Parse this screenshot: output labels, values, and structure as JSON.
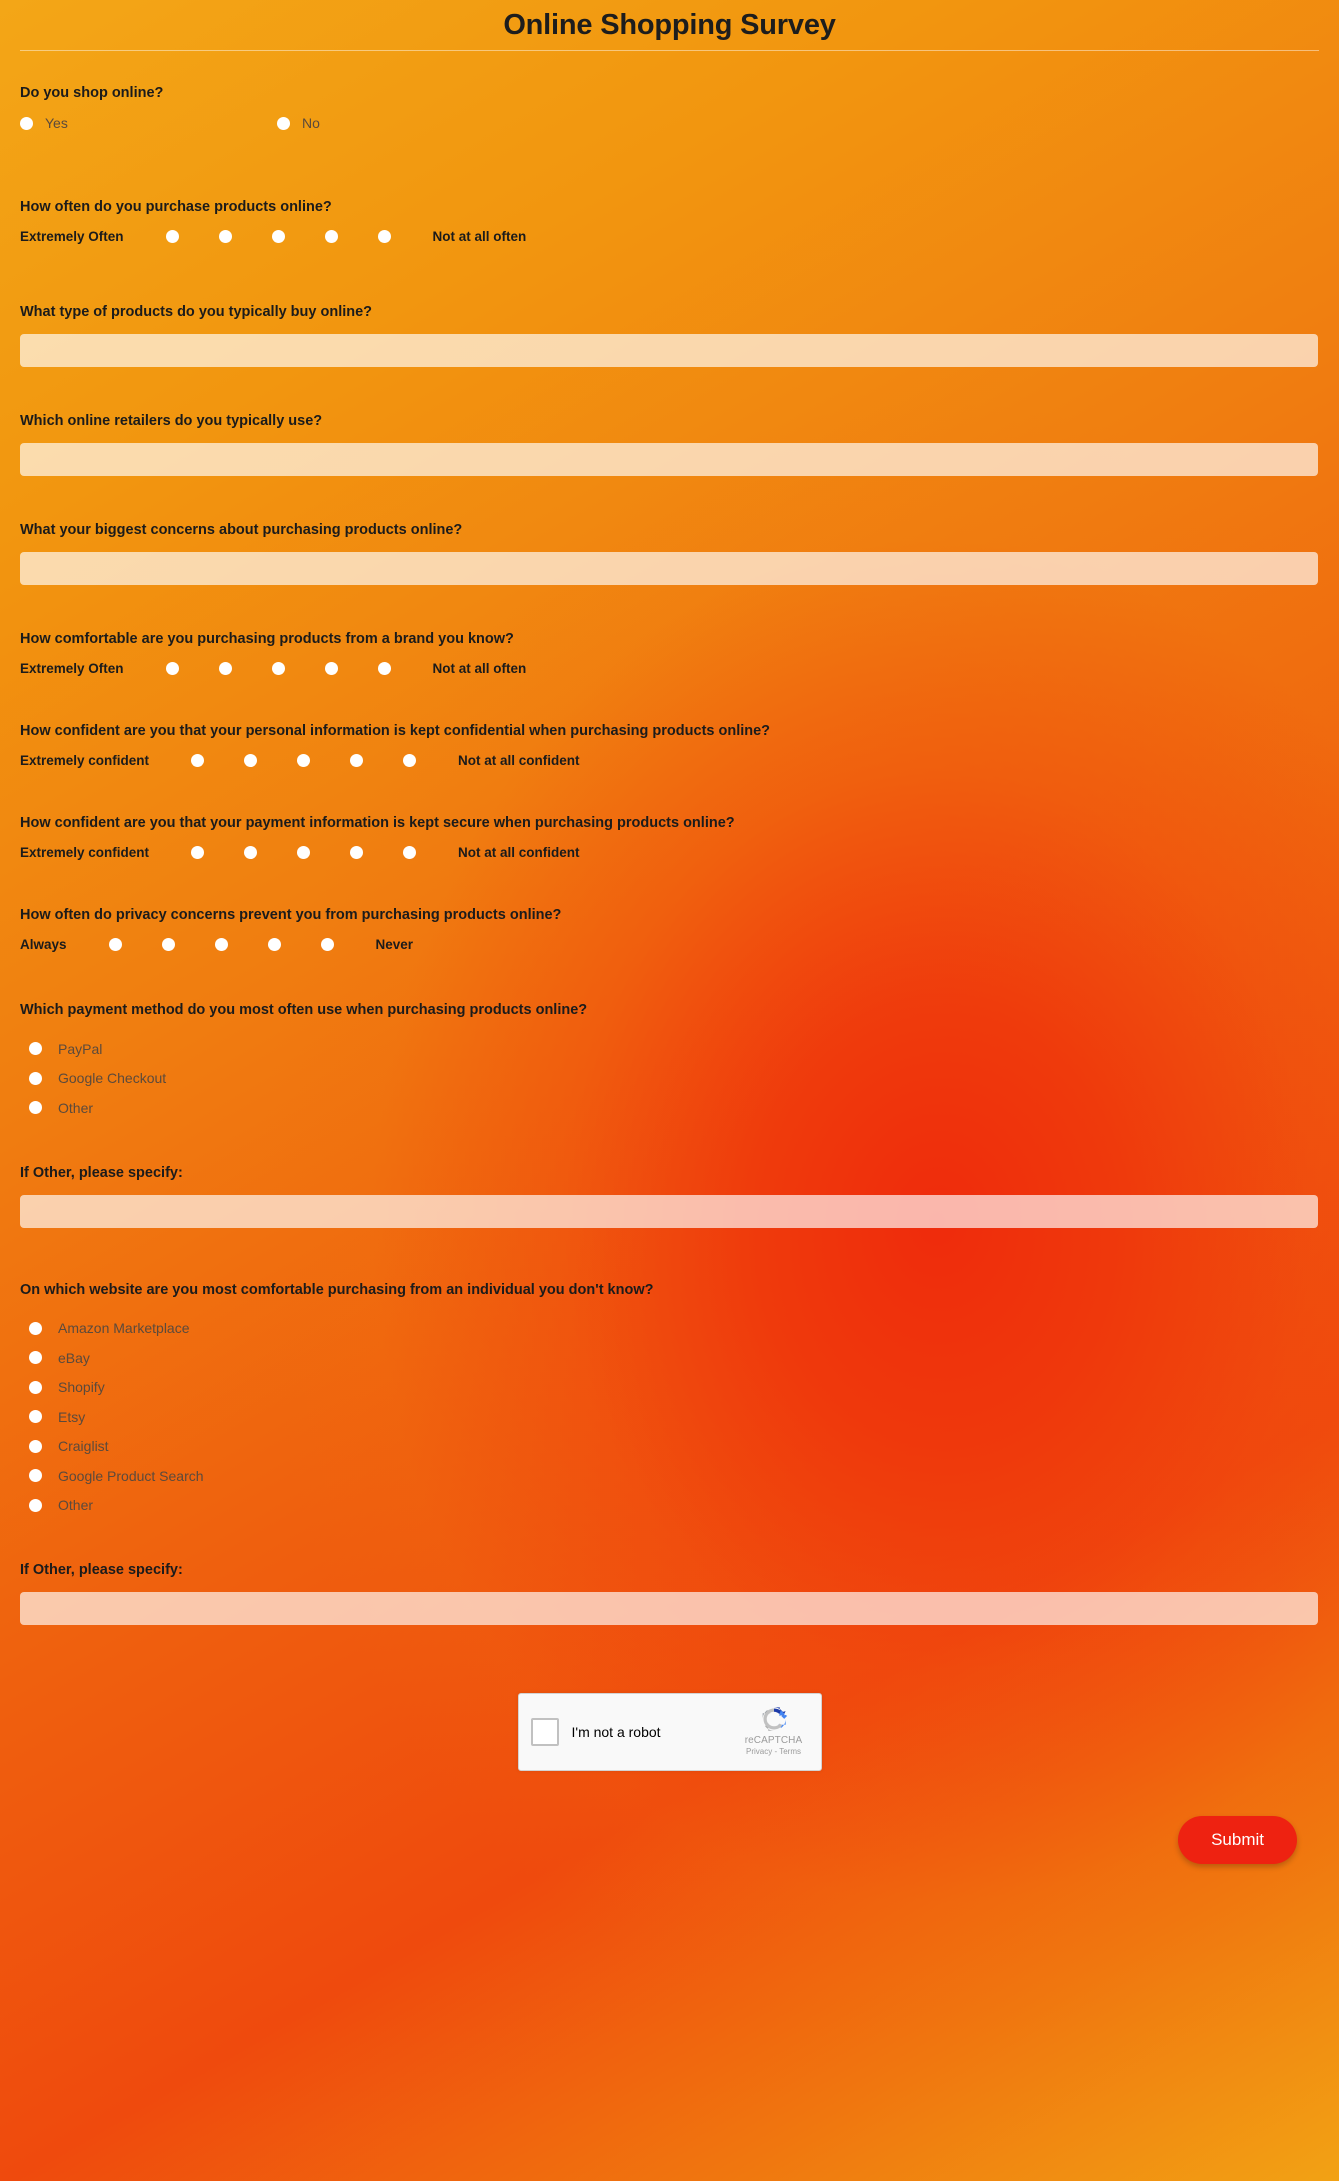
{
  "header": {
    "title": "Online Shopping Survey"
  },
  "questions": {
    "shop_online": {
      "label": "Do you shop online?",
      "options": [
        "Yes",
        "No"
      ]
    },
    "purchase_frequency": {
      "label": "How often do you purchase products online?",
      "left_anchor": "Extremely Often",
      "right_anchor": "Not at all often",
      "points": 5
    },
    "product_types": {
      "label": "What type of products do you typically buy online?",
      "value": "",
      "placeholder": ""
    },
    "retailers": {
      "label": "Which online retailers do you typically use?",
      "value": "",
      "placeholder": ""
    },
    "concerns": {
      "label": "What your biggest concerns about purchasing products online?",
      "value": "",
      "placeholder": ""
    },
    "brand_comfort": {
      "label": "How comfortable are you purchasing products from a brand you know?",
      "left_anchor": "Extremely Often",
      "right_anchor": "Not at all often",
      "points": 5
    },
    "personal_info_confidence": {
      "label": "How confident are you that your personal information is kept confidential when purchasing products online?",
      "left_anchor": "Extremely confident",
      "right_anchor": "Not at all confident",
      "points": 5
    },
    "payment_info_confidence": {
      "label": "How confident are you that your payment information is kept secure when purchasing products online?",
      "left_anchor": "Extremely confident",
      "right_anchor": "Not at all confident",
      "points": 5
    },
    "privacy_prevent": {
      "label": "How often do privacy concerns prevent you from purchasing products online?",
      "left_anchor": "Always",
      "right_anchor": "Never",
      "points": 5
    },
    "payment_method": {
      "label": "Which payment method do you most often use when purchasing products online?",
      "options": [
        "PayPal",
        "Google Checkout",
        "Other"
      ]
    },
    "payment_method_other": {
      "label": "If Other, please specify:",
      "value": "",
      "placeholder": ""
    },
    "website_comfort": {
      "label": "On which website are you most comfortable purchasing from an individual you don't know?",
      "options": [
        "Amazon Marketplace",
        "eBay",
        "Shopify",
        "Etsy",
        "Craiglist",
        "Google Product Search",
        "Other"
      ]
    },
    "website_other": {
      "label": "If Other, please specify:",
      "value": "",
      "placeholder": ""
    }
  },
  "captcha": {
    "label": "I'm not a robot",
    "brand": "reCAPTCHA",
    "privacy": "Privacy",
    "separator": " - ",
    "terms": "Terms"
  },
  "footer": {
    "submit_label": "Submit"
  },
  "colors": {
    "accent": "#ee2211",
    "background_start": "#f3a617",
    "background_end": "#ef2b0c",
    "input_fill": "#fad8bb",
    "text": "#1b1b1b"
  }
}
